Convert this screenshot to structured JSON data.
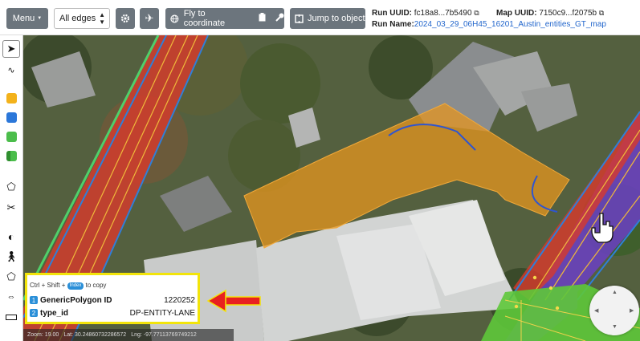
{
  "toolbar": {
    "menu_label": "Menu",
    "edges_select_value": "All edges",
    "fly_label": "Fly to coordinate",
    "jump_label": "Jump to object"
  },
  "run": {
    "uuid_label": "Run UUID:",
    "uuid_value": "fc18a8...7b5490",
    "name_label": "Run Name:",
    "name_value": "2024_03_29_06H45_16201_Austin_entities_GT_map"
  },
  "map_info": {
    "uuid_label": "Map UUID:",
    "uuid_value": "7150c9...f2075b"
  },
  "popup": {
    "hint_prefix": "Ctrl + Shift +",
    "hint_key": "Index",
    "hint_suffix": "to copy",
    "rows": [
      {
        "index": "1",
        "key": "GenericPolygon ID",
        "value": "1220252"
      },
      {
        "index": "2",
        "key": "type_id",
        "value": "DP-ENTITY-LANE"
      }
    ]
  },
  "status": {
    "zoom_label": "Zoom:",
    "zoom_value": "19.00",
    "lat_label": "Lat:",
    "lat_value": "30.24860732286572",
    "lng_label": "Lng:",
    "lng_value": "-97.77113769749212"
  },
  "colors": {
    "lane_red": "#d83a2c",
    "lane_purple": "#6b3fc4",
    "lane_green": "#5ec83a",
    "polygon_orange": "#e5951f",
    "highlight_yellow": "#f2e40a",
    "toolbar_button": "#6c757d"
  },
  "icons": [
    "settings-gear-icon",
    "airplane-icon",
    "globe-icon",
    "clipboard-icon",
    "key-icon",
    "crosshair-icon",
    "copy-icon",
    "pointer-icon",
    "pan-cursor-icon"
  ]
}
